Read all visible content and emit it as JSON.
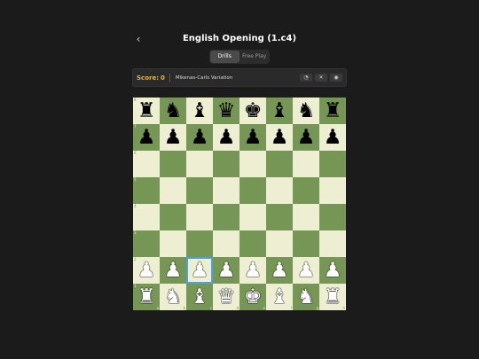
{
  "header": {
    "back_icon": "chevron-left-icon",
    "back_glyph": "‹",
    "title": "English Opening (1.c4)"
  },
  "modes": {
    "drills_label": "Drills",
    "free_play_label": "Free Play",
    "active": "drills"
  },
  "score_bar": {
    "score_label": "Score:",
    "score_value": "0",
    "variation": "Mikenas-Carls Variation",
    "buttons": [
      {
        "name": "hint-icon",
        "glyph": "◔"
      },
      {
        "name": "close-icon",
        "glyph": "✕"
      },
      {
        "name": "eye-icon",
        "glyph": "◉"
      }
    ]
  },
  "board": {
    "colors": {
      "light": "#eeeed2",
      "dark": "#769656",
      "highlight": "#4aa3df"
    },
    "ranks": [
      "8",
      "7",
      "6",
      "5",
      "4",
      "3",
      "2",
      "1"
    ],
    "files": [
      "a",
      "b",
      "c",
      "d",
      "e",
      "f",
      "g",
      "h"
    ],
    "position": [
      [
        "r",
        "n",
        "b",
        "q",
        "k",
        "b",
        "n",
        "r"
      ],
      [
        "p",
        "p",
        "p",
        "p",
        "p",
        "p",
        "p",
        "p"
      ],
      [
        "",
        "",
        "",
        "",
        "",
        "",
        "",
        ""
      ],
      [
        "",
        "",
        "",
        "",
        "",
        "",
        "",
        ""
      ],
      [
        "",
        "",
        "",
        "",
        "",
        "",
        "",
        ""
      ],
      [
        "",
        "",
        "",
        "",
        "",
        "",
        "",
        ""
      ],
      [
        "P",
        "P",
        "P",
        "P",
        "P",
        "P",
        "P",
        "P"
      ],
      [
        "R",
        "N",
        "B",
        "Q",
        "K",
        "B",
        "N",
        "R"
      ]
    ],
    "selected_square": "c2"
  }
}
